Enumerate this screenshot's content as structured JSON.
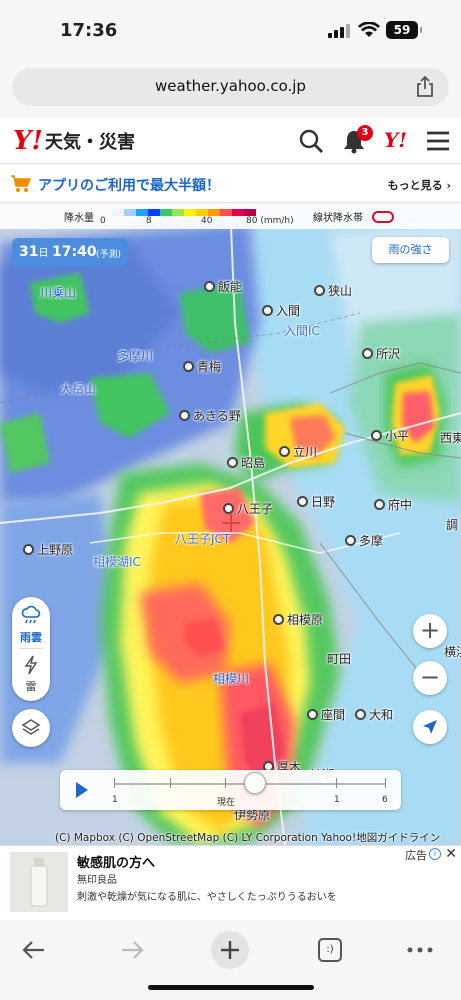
{
  "status_bar": {
    "time": "17:36",
    "battery": "59"
  },
  "browser": {
    "url": "weather.yahoo.co.jp"
  },
  "site": {
    "logo_y": "Y!",
    "logo_text": "天気・災害",
    "notification_count": "3",
    "y_icon": "Y!"
  },
  "promo": {
    "text": "アプリのご利用で最大半額！",
    "more": "もっと見る ›"
  },
  "map": {
    "legend": {
      "title": "降水量",
      "ticks": [
        "0",
        "8",
        "40",
        "80 (mm/h)"
      ],
      "linear_band_label": "線状降水帯",
      "colors": [
        "#f2f2ff",
        "#a0d2ff",
        "#21a1ff",
        "#0041ff",
        "#33cc66",
        "#99e64d",
        "#fff20a",
        "#ffcc00",
        "#ff9900",
        "#ff5050",
        "#e6004d",
        "#b4004d"
      ]
    },
    "time_chip": {
      "day": "31",
      "day_unit": "日",
      "time": "17:40",
      "forecast": "(予測)"
    },
    "intensity_button": "雨の強さ",
    "places": [
      {
        "name": "川乗山",
        "type": "river"
      },
      {
        "name": "飯能",
        "type": "dot"
      },
      {
        "name": "狭山",
        "type": "dot"
      },
      {
        "name": "入間",
        "type": "dot"
      },
      {
        "name": "入間IC",
        "type": "ic"
      },
      {
        "name": "多摩川",
        "type": "river"
      },
      {
        "name": "青梅",
        "type": "dot"
      },
      {
        "name": "所沢",
        "type": "dot"
      },
      {
        "name": "大岳山",
        "type": "river"
      },
      {
        "name": "あきる野",
        "type": "dot"
      },
      {
        "name": "小平",
        "type": "dot"
      },
      {
        "name": "西東",
        "type": "plain"
      },
      {
        "name": "立川",
        "type": "dot"
      },
      {
        "name": "昭島",
        "type": "dot"
      },
      {
        "name": "八王子",
        "type": "dot"
      },
      {
        "name": "日野",
        "type": "dot"
      },
      {
        "name": "府中",
        "type": "dot"
      },
      {
        "name": "調",
        "type": "plain"
      },
      {
        "name": "八王子JCT",
        "type": "ic"
      },
      {
        "name": "上野原",
        "type": "dot"
      },
      {
        "name": "相模湖IC",
        "type": "ic"
      },
      {
        "name": "多摩",
        "type": "dot"
      },
      {
        "name": "相模原",
        "type": "dot"
      },
      {
        "name": "町田",
        "type": "plain"
      },
      {
        "name": "横浜",
        "type": "plain"
      },
      {
        "name": "相模川",
        "type": "river"
      },
      {
        "name": "座間",
        "type": "dot"
      },
      {
        "name": "大和",
        "type": "dot"
      },
      {
        "name": "厚木",
        "type": "dot"
      },
      {
        "name": "綾瀬",
        "type": "plain"
      },
      {
        "name": "伊勢原",
        "type": "plain"
      }
    ],
    "side_panel": {
      "rain_label": "雨雲",
      "thunder_label": "雷"
    },
    "zoom_in": "+",
    "zoom_out": "−",
    "timeline": {
      "labels": [
        "1",
        "現在",
        "1",
        "6"
      ],
      "position_label": "現在"
    },
    "attribution": "(C) Mapbox (C) OpenStreetMap (C) LY Corporation Yahoo!地図ガイドライン"
  },
  "ad": {
    "title": "敏感肌の方へ",
    "brand": "無印良品",
    "description": "刺激や乾燥が気になる肌に、やさしくたっぷりうるおいを",
    "label": "広告",
    "info": "i",
    "close": "✕"
  },
  "toolbar": {
    "tabs_label": ":)"
  }
}
